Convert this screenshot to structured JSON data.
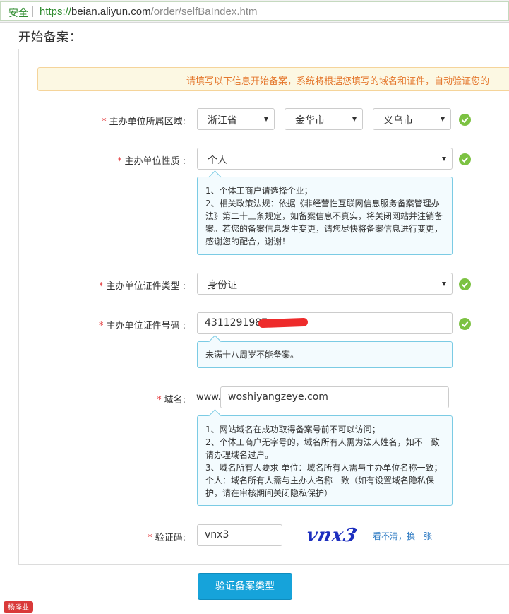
{
  "browser": {
    "secure_label": "安全",
    "url_scheme": "https://",
    "url_host": "beian.aliyun.com",
    "url_path": "/order/selfBaIndex.htm"
  },
  "page": {
    "title": "开始备案："
  },
  "notice": {
    "text": "请填写以下信息开始备案，系统将根据您填写的域名和证件，自动验证您的"
  },
  "region": {
    "label": "主办单位所属区域:",
    "province": "浙江省",
    "city": "金华市",
    "county": "义乌市"
  },
  "org_type": {
    "label": "主办单位性质 :",
    "value": "个人",
    "tips": [
      "1、个体工商户请选择企业；",
      "2、相关政策法规：依据《非经营性互联网信息服务备案管理办",
      "法》第二十三条规定，如备案信息不真实，将关闭网站并注销备",
      "案。若您的备案信息发生变更，请您尽快将备案信息进行变更，",
      "感谢您的配合，谢谢！"
    ]
  },
  "id_type": {
    "label": "主办单位证件类型 :",
    "value": "身份证"
  },
  "id_number": {
    "label": "主办单位证件号码 :",
    "value": "4311291987",
    "tip": "未满十八周岁不能备案。"
  },
  "domain": {
    "label": "域名:",
    "prefix": "www.",
    "value": "woshiyangzeye.com",
    "tips": [
      "1、网站域名在成功取得备案号前不可以访问；",
      "2、个体工商户无字号的，域名所有人需为法人姓名，如不一致",
      "请办理域名过户。",
      "3、域名所有人要求 单位：域名所有人需与主办单位名称一致；",
      "个人：域名所有人需与主办人名称一致（如有设置域名隐私保",
      "护，请在审核期间关闭隐私保护）"
    ]
  },
  "captcha": {
    "label": "验证码:",
    "value": "vnx3",
    "image_text": "vnx3",
    "refresh_label": "看不清，换一张"
  },
  "required_mark": "*",
  "submit_label": "验证备案类型",
  "watermark_text": "杨泽业",
  "colors": {
    "accent": "#16a3da",
    "check": "#7cc242",
    "required": "#e4393c",
    "notice_text": "#e4762b",
    "link": "#2a78c2"
  }
}
